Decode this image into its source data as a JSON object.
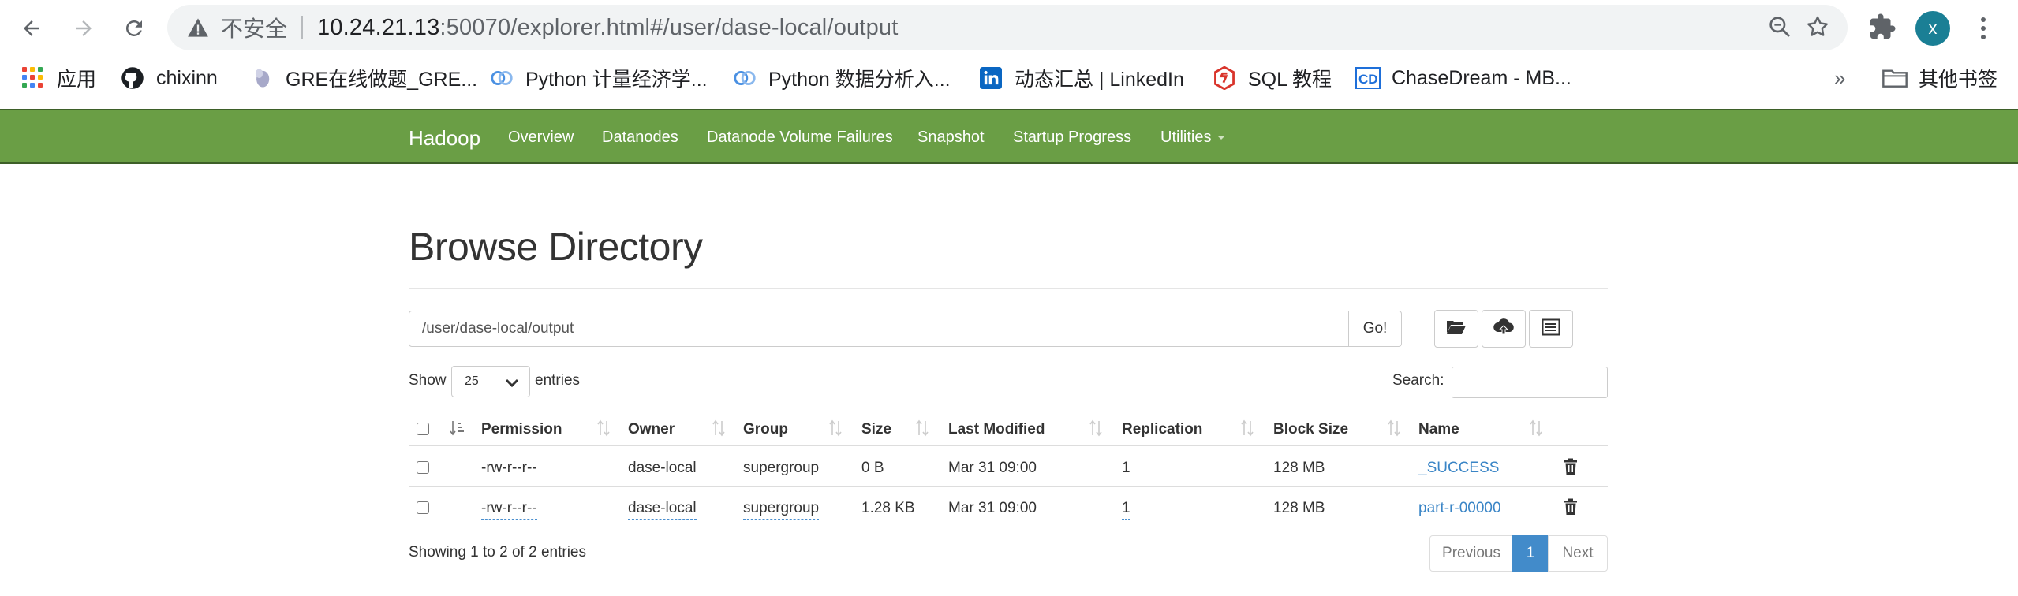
{
  "browser": {
    "insecure_label": "不安全",
    "url_host": "10.24.21.13",
    "url_rest": ":50070/explorer.html#/user/dase-local/output",
    "profile_initial": "x",
    "bookmarks": [
      {
        "label": "应用",
        "icon": "apps-grid-icon"
      },
      {
        "label": "chixinn",
        "icon": "github-icon"
      },
      {
        "label": "GRE在线做题_GRE...",
        "icon": "gre-icon"
      },
      {
        "label": "Python 计量经济学...",
        "icon": "python-site-icon"
      },
      {
        "label": "Python 数据分析入...",
        "icon": "python-site-icon"
      },
      {
        "label": "动态汇总 | LinkedIn",
        "icon": "linkedin-icon"
      },
      {
        "label": "SQL 教程",
        "icon": "sql-icon"
      },
      {
        "label": "ChaseDream - MB...",
        "icon": "chasedream-icon"
      }
    ],
    "more_bookmarks": "»",
    "other_bookmarks": "其他书签"
  },
  "navbar": {
    "brand": "Hadoop",
    "links": [
      "Overview",
      "Datanodes",
      "Datanode Volume Failures",
      "Snapshot",
      "Startup Progress",
      "Utilities"
    ],
    "color": "#6a9e45"
  },
  "page": {
    "title": "Browse Directory",
    "path_value": "/user/dase-local/output",
    "go_label": "Go!",
    "show_label": "Show",
    "entries_select": "25",
    "entries_label": "entries",
    "search_label": "Search:"
  },
  "table": {
    "columns": [
      "Permission",
      "Owner",
      "Group",
      "Size",
      "Last Modified",
      "Replication",
      "Block Size",
      "Name"
    ],
    "rows": [
      {
        "permission": "-rw-r--r--",
        "owner": "dase-local",
        "group": "supergroup",
        "size": "0 B",
        "modified": "Mar 31 09:00",
        "replication": "1",
        "block_size": "128 MB",
        "name": "_SUCCESS"
      },
      {
        "permission": "-rw-r--r--",
        "owner": "dase-local",
        "group": "supergroup",
        "size": "1.28 KB",
        "modified": "Mar 31 09:00",
        "replication": "1",
        "block_size": "128 MB",
        "name": "part-r-00000"
      }
    ]
  },
  "footer": {
    "info": "Showing 1 to 2 of 2 entries",
    "previous": "Previous",
    "current_page": "1",
    "next": "Next"
  }
}
